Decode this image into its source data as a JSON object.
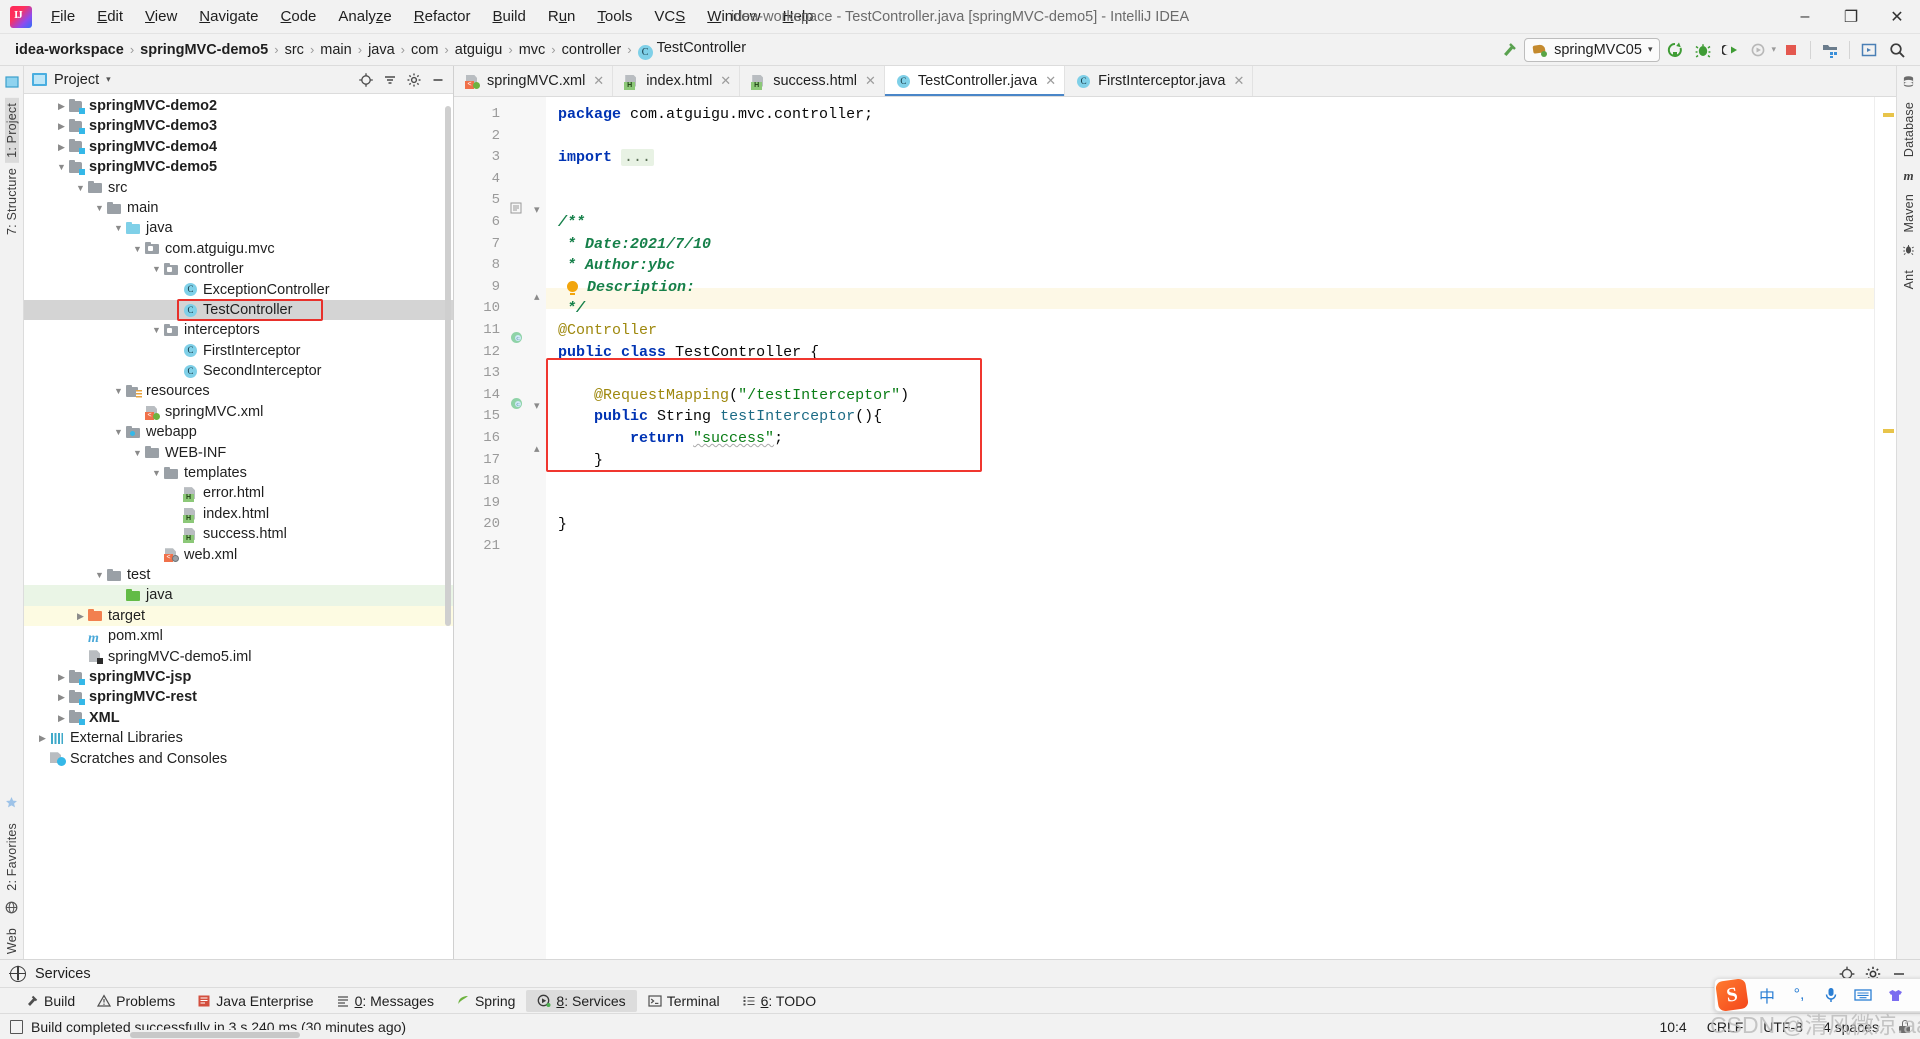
{
  "window": {
    "title": "idea-workspace - TestController.java [springMVC-demo5] - IntelliJ IDEA",
    "minimize": "–",
    "maximize": "❐",
    "close": "✕"
  },
  "menubar": {
    "items": [
      {
        "label": "File"
      },
      {
        "label": "Edit"
      },
      {
        "label": "View"
      },
      {
        "label": "Navigate"
      },
      {
        "label": "Code"
      },
      {
        "label": "Analyze"
      },
      {
        "label": "Refactor"
      },
      {
        "label": "Build"
      },
      {
        "label": "Run"
      },
      {
        "label": "Tools"
      },
      {
        "label": "VCS"
      },
      {
        "label": "Window"
      },
      {
        "label": "Help"
      }
    ]
  },
  "breadcrumb": {
    "items": [
      {
        "label": "idea-workspace",
        "bold": true
      },
      {
        "label": "springMVC-demo5",
        "bold": true
      },
      {
        "label": "src",
        "bold": false
      },
      {
        "label": "main",
        "bold": false
      },
      {
        "label": "java",
        "bold": false
      },
      {
        "label": "com",
        "bold": false
      },
      {
        "label": "atguigu",
        "bold": false
      },
      {
        "label": "mvc",
        "bold": false
      },
      {
        "label": "controller",
        "bold": false
      },
      {
        "label": "TestController",
        "bold": false,
        "icon": "class-icon",
        "icon_letter": "C"
      }
    ],
    "separator": "›"
  },
  "run_toolbar": {
    "config_name": "springMVC05",
    "config_caret": "▾",
    "buttons": [
      {
        "name": "update-application-icon"
      },
      {
        "name": "debug-icon"
      },
      {
        "name": "run-with-coverage-icon"
      },
      {
        "name": "profiler-icon"
      },
      {
        "name": "stop-icon"
      },
      {
        "name": "open-project-structure-icon"
      },
      {
        "name": "show-in-browser-icon"
      },
      {
        "name": "search-everywhere-icon"
      }
    ]
  },
  "left_strip": {
    "items": [
      {
        "label": "1: Project",
        "active": true
      },
      {
        "label": "7: Structure",
        "active": false
      },
      {
        "label": "2: Favorites",
        "active": false
      },
      {
        "label": "Web",
        "active": false
      }
    ]
  },
  "right_strip": {
    "items": [
      {
        "label": "Database"
      },
      {
        "label": "Maven"
      },
      {
        "label": "Ant"
      }
    ]
  },
  "project_panel": {
    "title": "Project",
    "caret": "▾",
    "tools": [
      {
        "name": "locate-file-icon"
      },
      {
        "name": "collapse-all-icon"
      },
      {
        "name": "settings-gear-icon"
      },
      {
        "name": "hide-panel-icon"
      }
    ],
    "tree": [
      {
        "depth": 1,
        "label": "springMVC-demo2",
        "arrow": "▶",
        "icon": "module-icon",
        "bold": true
      },
      {
        "depth": 1,
        "label": "springMVC-demo3",
        "arrow": "▶",
        "icon": "module-icon",
        "bold": true
      },
      {
        "depth": 1,
        "label": "springMVC-demo4",
        "arrow": "▶",
        "icon": "module-icon",
        "bold": true
      },
      {
        "depth": 1,
        "label": "springMVC-demo5",
        "arrow": "▼",
        "icon": "module-icon",
        "bold": true
      },
      {
        "depth": 2,
        "label": "src",
        "arrow": "▼",
        "icon": "folder-icon"
      },
      {
        "depth": 3,
        "label": "main",
        "arrow": "▼",
        "icon": "folder-icon"
      },
      {
        "depth": 4,
        "label": "java",
        "arrow": "▼",
        "icon": "source-root-icon"
      },
      {
        "depth": 5,
        "label": "com.atguigu.mvc",
        "arrow": "▼",
        "icon": "package-icon"
      },
      {
        "depth": 6,
        "label": "controller",
        "arrow": "▼",
        "icon": "package-icon"
      },
      {
        "depth": 7,
        "label": "ExceptionController",
        "arrow": "",
        "icon": "class-icon"
      },
      {
        "depth": 7,
        "label": "TestController",
        "arrow": "",
        "icon": "class-icon",
        "selected": true,
        "highlighted": true
      },
      {
        "depth": 6,
        "label": "interceptors",
        "arrow": "▼",
        "icon": "package-icon"
      },
      {
        "depth": 7,
        "label": "FirstInterceptor",
        "arrow": "",
        "icon": "class-icon"
      },
      {
        "depth": 7,
        "label": "SecondInterceptor",
        "arrow": "",
        "icon": "class-icon"
      },
      {
        "depth": 4,
        "label": "resources",
        "arrow": "▼",
        "icon": "resource-root-icon"
      },
      {
        "depth": 5,
        "label": "springMVC.xml",
        "arrow": "",
        "icon": "spring-xml-icon"
      },
      {
        "depth": 4,
        "label": "webapp",
        "arrow": "▼",
        "icon": "web-root-icon"
      },
      {
        "depth": 5,
        "label": "WEB-INF",
        "arrow": "▼",
        "icon": "folder-icon"
      },
      {
        "depth": 6,
        "label": "templates",
        "arrow": "▼",
        "icon": "folder-icon"
      },
      {
        "depth": 7,
        "label": "error.html",
        "arrow": "",
        "icon": "html-file-icon"
      },
      {
        "depth": 7,
        "label": "index.html",
        "arrow": "",
        "icon": "html-file-icon"
      },
      {
        "depth": 7,
        "label": "success.html",
        "arrow": "",
        "icon": "html-file-icon"
      },
      {
        "depth": 6,
        "label": "web.xml",
        "arrow": "",
        "icon": "web-xml-icon"
      },
      {
        "depth": 3,
        "label": "test",
        "arrow": "▼",
        "icon": "folder-icon"
      },
      {
        "depth": 4,
        "label": "java",
        "arrow": "",
        "icon": "test-source-root-icon",
        "row_bg": "green"
      },
      {
        "depth": 2,
        "label": "target",
        "arrow": "▶",
        "icon": "excluded-folder-icon",
        "row_bg": "yellow"
      },
      {
        "depth": 2,
        "label": "pom.xml",
        "arrow": "",
        "icon": "maven-icon"
      },
      {
        "depth": 2,
        "label": "springMVC-demo5.iml",
        "arrow": "",
        "icon": "iml-file-icon"
      },
      {
        "depth": 1,
        "label": "springMVC-jsp",
        "arrow": "▶",
        "icon": "module-icon",
        "bold": true
      },
      {
        "depth": 1,
        "label": "springMVC-rest",
        "arrow": "▶",
        "icon": "module-icon",
        "bold": true
      },
      {
        "depth": 1,
        "label": "XML",
        "arrow": "▶",
        "icon": "module-icon",
        "bold": true
      },
      {
        "depth": 0,
        "label": "External Libraries",
        "arrow": "▶",
        "icon": "libraries-icon"
      },
      {
        "depth": 0,
        "label": "Scratches and Consoles",
        "arrow": "",
        "icon": "scratches-icon"
      }
    ]
  },
  "editor": {
    "tabs": [
      {
        "label": "springMVC.xml",
        "icon": "spring-xml-icon",
        "active": false,
        "close": "✕"
      },
      {
        "label": "index.html",
        "icon": "html-file-icon",
        "active": false,
        "close": "✕"
      },
      {
        "label": "success.html",
        "icon": "html-file-icon",
        "active": false,
        "close": "✕"
      },
      {
        "label": "TestController.java",
        "icon": "class-icon",
        "active": true,
        "close": "✕"
      },
      {
        "label": "FirstInterceptor.java",
        "icon": "class-icon",
        "active": false,
        "close": "✕"
      }
    ],
    "line_numbers": [
      "1",
      "2",
      "3",
      "4",
      "5",
      "6",
      "7",
      "8",
      "9",
      "10",
      "11",
      "12",
      "13",
      "14",
      "15",
      "16",
      "17",
      "18",
      "19",
      "20",
      "21"
    ],
    "caret_line": 10,
    "code_lines": [
      {
        "n": 1,
        "text": "package com.atguigu.mvc.controller;"
      },
      {
        "n": 2,
        "text": ""
      },
      {
        "n": 3,
        "text": "import ..."
      },
      {
        "n": 4,
        "text": ""
      },
      {
        "n": 5,
        "text": ""
      },
      {
        "n": 6,
        "text": "/**"
      },
      {
        "n": 7,
        "text": " * Date:2021/7/10"
      },
      {
        "n": 8,
        "text": " * Author:ybc"
      },
      {
        "n": 9,
        "text": " * Description:"
      },
      {
        "n": 10,
        "text": " */"
      },
      {
        "n": 11,
        "text": "@Controller"
      },
      {
        "n": 12,
        "text": "public class TestController {"
      },
      {
        "n": 13,
        "text": ""
      },
      {
        "n": 14,
        "text": "    @RequestMapping(\"/testInterceptor\")"
      },
      {
        "n": 15,
        "text": "    public String testInterceptor(){"
      },
      {
        "n": 16,
        "text": "        return \"success\";"
      },
      {
        "n": 17,
        "text": "    }"
      },
      {
        "n": 18,
        "text": ""
      },
      {
        "n": 19,
        "text": ""
      },
      {
        "n": 20,
        "text": "}"
      },
      {
        "n": 21,
        "text": ""
      }
    ],
    "import_placeholder": "...",
    "fold_markers": {
      "line6": "⊖",
      "line10": "⊕",
      "line15": "⊖",
      "line17": "⊕"
    }
  },
  "services_panel": {
    "title": "Services",
    "buttons": [
      {
        "name": "settings-target-icon"
      },
      {
        "name": "gear-icon"
      },
      {
        "name": "minimize-icon"
      }
    ]
  },
  "toolwindow_bar": {
    "items": [
      {
        "label": "Build",
        "icon": "build-hammer-icon",
        "active": false
      },
      {
        "label": "Problems",
        "icon": "warning-triangle-icon",
        "active": false
      },
      {
        "label": "Java Enterprise",
        "icon": "java-enterprise-icon",
        "active": false
      },
      {
        "label": "0: Messages",
        "icon": "messages-icon",
        "active": false
      },
      {
        "label": "Spring",
        "icon": "spring-leaf-icon",
        "active": false
      },
      {
        "label": "8: Services",
        "icon": "services-icon",
        "active": true
      },
      {
        "label": "Terminal",
        "icon": "terminal-icon",
        "active": false
      },
      {
        "label": "6: TODO",
        "icon": "todo-list-icon",
        "active": false
      }
    ]
  },
  "status_bar": {
    "message": "Build completed successfully in 3 s 240 ms (30 minutes ago)",
    "cells": [
      {
        "label": "10:4",
        "name": "caret-position"
      },
      {
        "label": "CRLF",
        "name": "line-separator"
      },
      {
        "label": "UTF-8",
        "name": "file-encoding"
      },
      {
        "label": "4 spaces",
        "name": "indent-setting"
      }
    ],
    "lock_icon": "read-only-lock-icon"
  },
  "ime_widget": {
    "logo": "S",
    "buttons": [
      {
        "label": "中",
        "name": "language-mode-button"
      },
      {
        "label": "°,",
        "name": "punctuation-mode-button"
      },
      {
        "label": "🎤",
        "name": "voice-input-button"
      },
      {
        "label": "⌨",
        "name": "soft-keyboard-button"
      },
      {
        "label": "👕",
        "name": "skin-button"
      },
      {
        "label": "☰",
        "name": "toolbox-button"
      }
    ]
  },
  "watermark": "CSDN @清风微凉.aaa",
  "colors": {
    "accent_blue": "#4a86c8",
    "selection_gray": "#d4d4d4",
    "highlight_red": "#f0362f",
    "keyword_blue": "#0033b3",
    "string_green": "#0a7d16",
    "comment_green": "#16804a",
    "annotation_gold": "#9e880d",
    "method_teal": "#1c6b85",
    "caret_row": "#fdf8e6"
  }
}
